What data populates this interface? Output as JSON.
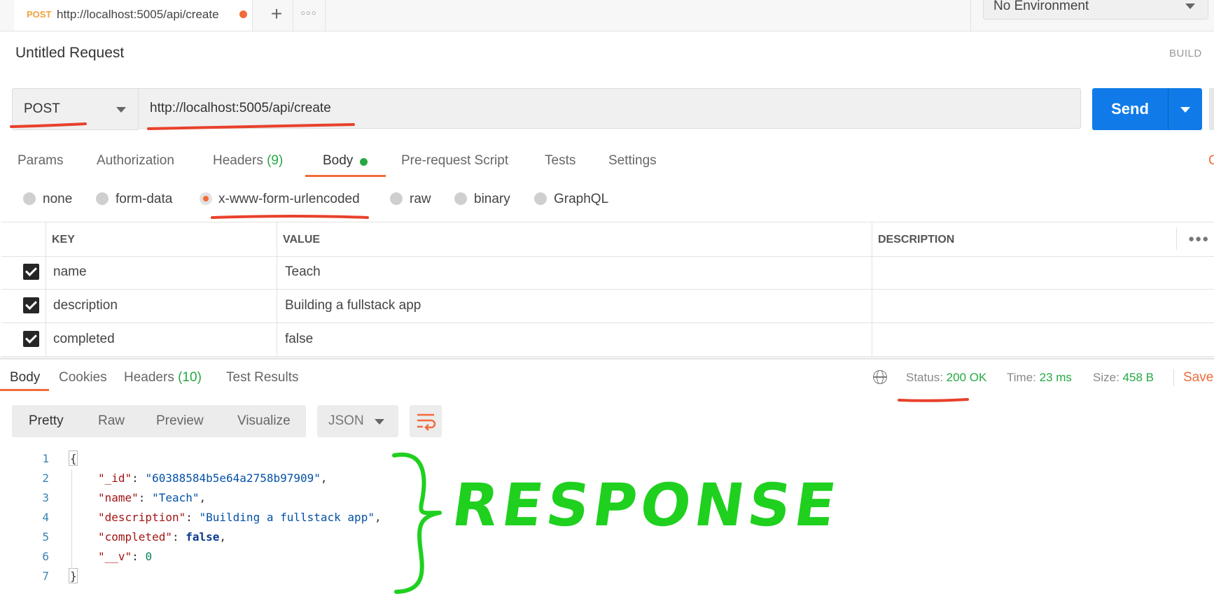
{
  "tab": {
    "method": "POST",
    "url": "http://localhost:5005/api/create"
  },
  "environment": {
    "label": "No Environment"
  },
  "request": {
    "title": "Untitled Request",
    "build_label": "BUILD",
    "method": "POST",
    "url": "http://localhost:5005/api/create",
    "send_label": "Send"
  },
  "request_tabs": {
    "params": "Params",
    "authorization": "Authorization",
    "headers": "Headers",
    "headers_count": "(9)",
    "body": "Body",
    "pre_request": "Pre-request Script",
    "tests": "Tests",
    "settings": "Settings",
    "clipped": "C"
  },
  "body_types": [
    "none",
    "form-data",
    "x-www-form-urlencoded",
    "raw",
    "binary",
    "GraphQL"
  ],
  "params_table": {
    "headers": [
      "KEY",
      "VALUE",
      "DESCRIPTION"
    ],
    "rows": [
      {
        "key": "name",
        "value": "Teach",
        "description": ""
      },
      {
        "key": "description",
        "value": "Building a fullstack app",
        "description": ""
      },
      {
        "key": "completed",
        "value": "false",
        "description": ""
      }
    ]
  },
  "response_tabs": {
    "body": "Body",
    "cookies": "Cookies",
    "headers": "Headers",
    "headers_count": "(10)",
    "test_results": "Test Results"
  },
  "response_meta": {
    "status_label": "Status:",
    "status_value": "200 OK",
    "time_label": "Time:",
    "time_value": "23 ms",
    "size_label": "Size:",
    "size_value": "458 B",
    "save_label": "Save"
  },
  "response_toolbar": {
    "formats": [
      "Pretty",
      "Raw",
      "Preview",
      "Visualize"
    ],
    "language": "JSON"
  },
  "response_code": {
    "line_numbers": [
      "1",
      "2",
      "3",
      "4",
      "5",
      "6",
      "7"
    ],
    "open_brace": "{",
    "close_brace": "}",
    "fields": [
      {
        "key": "\"_id\"",
        "value": "\"60388584b5e64a2758b97909\"",
        "type": "str",
        "comma": ","
      },
      {
        "key": "\"name\"",
        "value": "\"Teach\"",
        "type": "str",
        "comma": ","
      },
      {
        "key": "\"description\"",
        "value": "\"Building a fullstack app\"",
        "type": "str",
        "comma": ","
      },
      {
        "key": "\"completed\"",
        "value": "false",
        "type": "kw",
        "comma": ","
      },
      {
        "key": "\"__v\"",
        "value": "0",
        "type": "num",
        "comma": ""
      }
    ]
  },
  "annotation": {
    "text": "RESPONSE",
    "color": "#1fd01f"
  },
  "colors": {
    "accent": "#f26b3a",
    "send": "#107be8",
    "success": "#26a843"
  }
}
